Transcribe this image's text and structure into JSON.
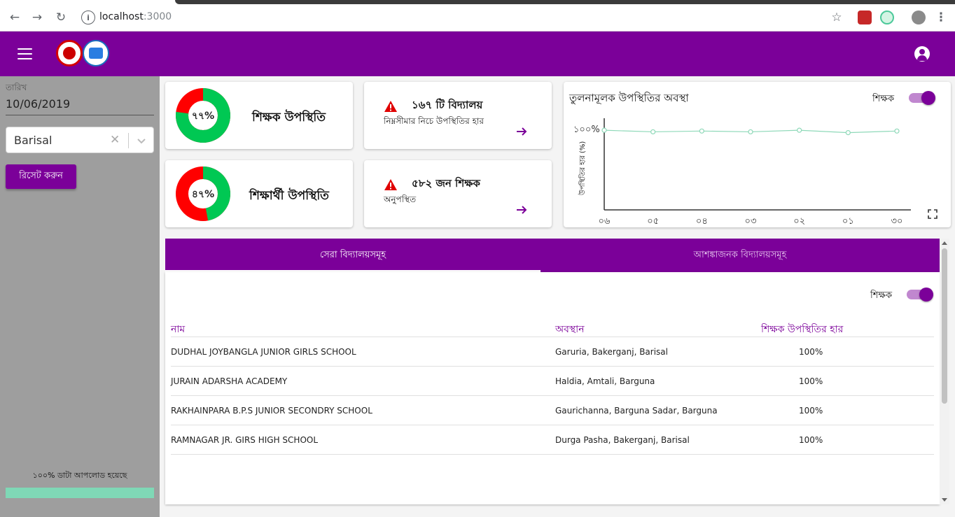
{
  "browser": {
    "url_host": "localhost",
    "url_port": ":3000"
  },
  "sidebar": {
    "date_label": "তারিখ",
    "date_value": "10/06/2019",
    "region_select_value": "Barisal",
    "reset_button_label": "রিসেট করুন",
    "upload_status": "১০০% ডাটা আপলোড হয়েছে",
    "upload_progress": 1.0
  },
  "cards": {
    "teacher_attendance": {
      "percent_label": "৭৭%",
      "percent": 77,
      "title": "শিক্ষক উপস্থিতি"
    },
    "student_attendance": {
      "percent_label": "৪৭%",
      "percent": 47,
      "title": "শিক্ষার্থী উপস্থিতি"
    },
    "schools_below": {
      "title": "১৬৭ টি বিদ্যালয়",
      "subtitle": "নিম্নসীমার নিচে উপস্থিতির হার"
    },
    "absent_teachers": {
      "title": "৫৮২ জন শিক্ষক",
      "subtitle": "অনুপস্থিত"
    }
  },
  "comparison": {
    "title": "তুলনামূলক উপস্থিতির অবস্থা",
    "toggle_label": "শিক্ষক"
  },
  "chart_data": {
    "type": "line",
    "title": "",
    "ylabel": "উপস্থিতির হার (%)",
    "y_tick_label": "১০০%",
    "categories": [
      "০৬",
      "০৫",
      "০৪",
      "০৩",
      "০২",
      "০১",
      "৩০"
    ],
    "ylim": [
      0,
      100
    ],
    "series": [
      {
        "values": [
          99,
          97,
          98,
          97,
          99,
          96,
          98
        ],
        "color": "#8fd9b9"
      }
    ]
  },
  "tabs": [
    {
      "label": "সেরা বিদ্যালয়সমূহ",
      "active": true
    },
    {
      "label": "আশঙ্কাজনক বিদ্যালয়সমূহ",
      "active": false
    }
  ],
  "table": {
    "toggle_label": "শিক্ষক",
    "headers": [
      "নাম",
      "অবস্থান",
      "শিক্ষক উপস্থিতির হার"
    ],
    "rows": [
      [
        "DUDHAL JOYBANGLA JUNIOR GIRLS SCHOOL",
        "Garuria, Bakerganj, Barisal",
        "100%"
      ],
      [
        "JURAIN ADARSHA ACADEMY",
        "Haldia, Amtali, Barguna",
        "100%"
      ],
      [
        "RAKHAINPARA B.P.S JUNIOR SECONDRY SCHOOL",
        "Gaurichanna, Barguna Sadar, Barguna",
        "100%"
      ],
      [
        "RAMNAGAR JR. GIRS HIGH SCHOOL",
        "Durga Pasha, Bakerganj, Barisal",
        "100%"
      ]
    ]
  },
  "colors": {
    "brand": "#7b0099",
    "present": "#00c853",
    "absent": "#ff0000",
    "warning": "#e00000"
  }
}
